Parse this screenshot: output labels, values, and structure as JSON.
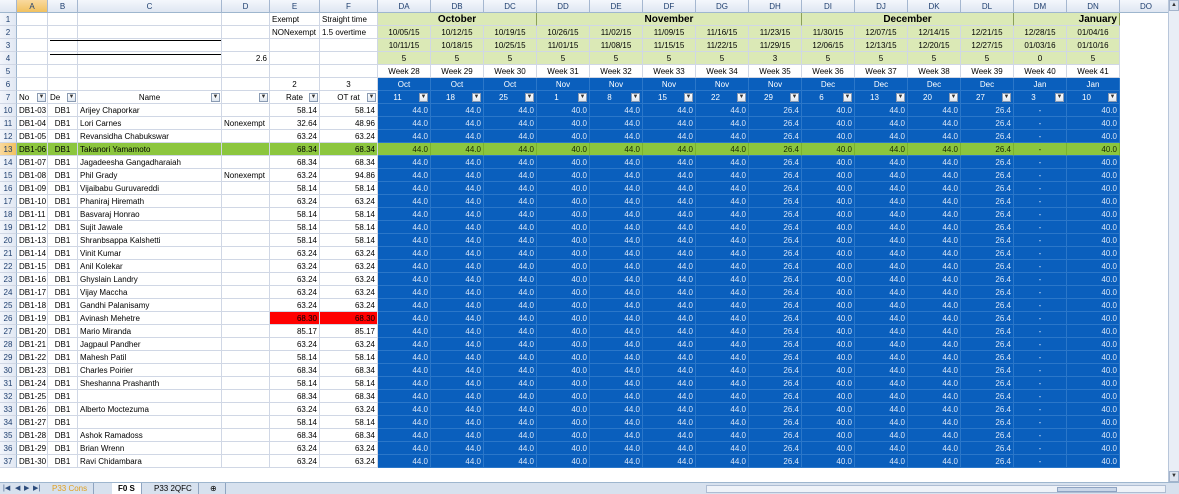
{
  "columns": {
    "letters": [
      "A",
      "B",
      "C",
      "D",
      "E",
      "F",
      "DA",
      "DB",
      "DC",
      "DD",
      "DE",
      "DF",
      "DG",
      "DH",
      "DI",
      "DJ",
      "DK",
      "DL",
      "DM",
      "DN",
      "DO"
    ]
  },
  "header_rows": {
    "r1_exempt": "Exempt",
    "r1_straight": "Straight time",
    "r2_nonexempt": "NONexempt",
    "r2_overtime": "1.5 overtime",
    "r4_value": "2.6",
    "r6_e": "2",
    "r6_f": "3",
    "months": [
      "October",
      "November",
      "December",
      "January"
    ],
    "week_start": [
      "10/05/15",
      "10/12/15",
      "10/19/15",
      "10/26/15",
      "11/02/15",
      "11/09/15",
      "11/16/15",
      "11/23/15",
      "11/30/15",
      "12/07/15",
      "12/14/15",
      "12/21/15",
      "12/28/15",
      "01/04/16",
      "01/11/16"
    ],
    "week_end": [
      "10/11/15",
      "10/18/15",
      "10/25/15",
      "11/01/15",
      "11/08/15",
      "11/15/15",
      "11/22/15",
      "11/29/15",
      "12/06/15",
      "12/13/15",
      "12/20/15",
      "12/27/15",
      "01/03/16",
      "01/10/16",
      "01/17/16"
    ],
    "days": [
      "5",
      "5",
      "5",
      "5",
      "5",
      "5",
      "5",
      "3",
      "5",
      "5",
      "5",
      "5",
      "0",
      "5",
      "5"
    ],
    "weeks": [
      "Week 28",
      "Week 29",
      "Week 30",
      "Week 31",
      "Week 32",
      "Week 33",
      "Week 34",
      "Week 35",
      "Week 36",
      "Week 37",
      "Week 38",
      "Week 39",
      "Week 40",
      "Week 41",
      "Week 42"
    ],
    "mon": [
      "Oct",
      "Oct",
      "Oct",
      "Nov",
      "Nov",
      "Nov",
      "Nov",
      "Nov",
      "Dec",
      "Dec",
      "Dec",
      "Dec",
      "Jan",
      "Jan",
      "Jan"
    ],
    "daynum": [
      "11",
      "18",
      "25",
      "1",
      "8",
      "15",
      "22",
      "29",
      "6",
      "13",
      "20",
      "27",
      "3",
      "10",
      "17"
    ]
  },
  "table_headers": {
    "no": "No",
    "dept": "De",
    "name": "Name",
    "rate": "Rate",
    "ot_rate": "OT rat"
  },
  "row_numbers": [
    "1",
    "2",
    "3",
    "4",
    "5",
    "6",
    "7",
    "10",
    "11",
    "12",
    "13",
    "14",
    "15",
    "16",
    "17",
    "18",
    "19",
    "20",
    "21",
    "22",
    "23",
    "24",
    "25",
    "26",
    "27",
    "28",
    "29",
    "30",
    "31",
    "32",
    "33",
    "34",
    "35",
    "36",
    "37"
  ],
  "hours": [
    "44.0",
    "44.0",
    "44.0",
    "40.0",
    "44.0",
    "44.0",
    "44.0",
    "26.4",
    "40.0",
    "44.0",
    "44.0",
    "26.4",
    "-",
    "40.0",
    "40.0"
  ],
  "rows": [
    {
      "no": "DB1-03",
      "dept": "DB1",
      "name": "Arijey Chaporkar",
      "type": "",
      "rate": "58.14",
      "ot": "58.14"
    },
    {
      "no": "DB1-04",
      "dept": "DB1",
      "name": "Lori Carnes",
      "type": "Nonexempt",
      "rate": "32.64",
      "ot": "48.96"
    },
    {
      "no": "DB1-05",
      "dept": "DB1",
      "name": "Revansidha Chabukswar",
      "type": "",
      "rate": "63.24",
      "ot": "63.24"
    },
    {
      "no": "DB1-06",
      "dept": "DB1",
      "name": "Takanori Yamamoto",
      "type": "",
      "rate": "68.34",
      "ot": "68.34"
    },
    {
      "no": "DB1-07",
      "dept": "DB1",
      "name": "Jagadeesha Gangadharaiah",
      "type": "",
      "rate": "68.34",
      "ot": "68.34"
    },
    {
      "no": "DB1-08",
      "dept": "DB1",
      "name": "Phil Grady",
      "type": "Nonexempt",
      "rate": "63.24",
      "ot": "94.86"
    },
    {
      "no": "DB1-09",
      "dept": "DB1",
      "name": "Vijaibabu Guruvareddi",
      "type": "",
      "rate": "58.14",
      "ot": "58.14"
    },
    {
      "no": "DB1-10",
      "dept": "DB1",
      "name": "Phaniraj Hiremath",
      "type": "",
      "rate": "63.24",
      "ot": "63.24"
    },
    {
      "no": "DB1-11",
      "dept": "DB1",
      "name": "Basvaraj Honrao",
      "type": "",
      "rate": "58.14",
      "ot": "58.14"
    },
    {
      "no": "DB1-12",
      "dept": "DB1",
      "name": "Sujit Jawale",
      "type": "",
      "rate": "58.14",
      "ot": "58.14"
    },
    {
      "no": "DB1-13",
      "dept": "DB1",
      "name": "Shranbsappa Kalshetti",
      "type": "",
      "rate": "58.14",
      "ot": "58.14"
    },
    {
      "no": "DB1-14",
      "dept": "DB1",
      "name": "Vinit Kumar",
      "type": "",
      "rate": "63.24",
      "ot": "63.24"
    },
    {
      "no": "DB1-15",
      "dept": "DB1",
      "name": "Anil Kolekar",
      "type": "",
      "rate": "63.24",
      "ot": "63.24"
    },
    {
      "no": "DB1-16",
      "dept": "DB1",
      "name": "Ghyslain Landry",
      "type": "",
      "rate": "63.24",
      "ot": "63.24"
    },
    {
      "no": "DB1-17",
      "dept": "DB1",
      "name": "Vijay Maccha",
      "type": "",
      "rate": "63.24",
      "ot": "63.24"
    },
    {
      "no": "DB1-18",
      "dept": "DB1",
      "name": "Gandhi Palanisamy",
      "type": "",
      "rate": "63.24",
      "ot": "63.24"
    },
    {
      "no": "DB1-19",
      "dept": "DB1",
      "name": "Avinash Mehetre",
      "type": "",
      "rate": "68.30",
      "ot": "68.30"
    },
    {
      "no": "DB1-20",
      "dept": "DB1",
      "name": "Mario Miranda",
      "type": "",
      "rate": "85.17",
      "ot": "85.17"
    },
    {
      "no": "DB1-21",
      "dept": "DB1",
      "name": "Jagpaul Pandher",
      "type": "",
      "rate": "63.24",
      "ot": "63.24"
    },
    {
      "no": "DB1-22",
      "dept": "DB1",
      "name": "Mahesh Patil",
      "type": "",
      "rate": "58.14",
      "ot": "58.14"
    },
    {
      "no": "DB1-23",
      "dept": "DB1",
      "name": "Charles Poirier",
      "type": "",
      "rate": "68.34",
      "ot": "68.34"
    },
    {
      "no": "DB1-24",
      "dept": "DB1",
      "name": "Sheshanna Prashanth",
      "type": "",
      "rate": "58.14",
      "ot": "58.14"
    },
    {
      "no": "DB1-25",
      "dept": "DB1",
      "name": "",
      "type": "",
      "rate": "68.34",
      "ot": "68.34"
    },
    {
      "no": "DB1-26",
      "dept": "DB1",
      "name": "Alberto Moctezuma",
      "type": "",
      "rate": "63.24",
      "ot": "63.24"
    },
    {
      "no": "DB1-27",
      "dept": "DB1",
      "name": "",
      "type": "",
      "rate": "58.14",
      "ot": "58.14"
    },
    {
      "no": "DB1-28",
      "dept": "DB1",
      "name": "Ashok Ramadoss",
      "type": "",
      "rate": "68.34",
      "ot": "68.34"
    },
    {
      "no": "DB1-29",
      "dept": "DB1",
      "name": "Brian Wrenn",
      "type": "",
      "rate": "63.24",
      "ot": "63.24"
    },
    {
      "no": "DB1-30",
      "dept": "DB1",
      "name": "Ravi Chidambara",
      "type": "",
      "rate": "63.24",
      "ot": "63.24"
    }
  ],
  "tabs": [
    "P33 Cons",
    "F0 S",
    "P33 2QFC"
  ],
  "colors": {
    "accent_blue": "#0a5fbd",
    "highlight_green": "#8cc63e",
    "month_band": "#dbe9b6",
    "alert_red": "#ff0000"
  }
}
